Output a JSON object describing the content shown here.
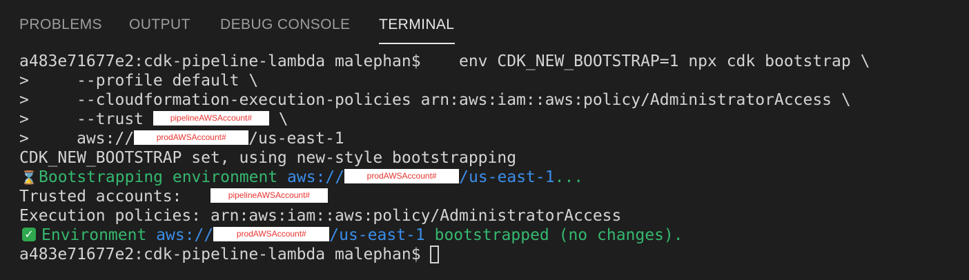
{
  "tabs": {
    "problems": "PROBLEMS",
    "output": "OUTPUT",
    "debug_console": "DEBUG CONSOLE",
    "terminal": "TERMINAL"
  },
  "terminal": {
    "prompt": "a483e71677e2:cdk-pipeline-lambda malephan$",
    "command": "    env CDK_NEW_BOOTSTRAP=1 npx cdk bootstrap \\",
    "cont1": ">     --profile default \\",
    "cont2": ">     --cloudformation-execution-policies arn:aws:iam::aws:policy/AdministratorAccess \\",
    "cont3_prefix": ">     --trust ",
    "cont3_redact": "pipelineAWSAccount#",
    "cont3_suffix": " \\",
    "cont4_prefix": ">     aws://",
    "cont4_redact": "prodAWSAccount#",
    "cont4_suffix": "/us-east-1",
    "out1": "CDK_NEW_BOOTSTRAP set, using new-style bootstrapping",
    "out2_text": "Bootstrapping environment ",
    "out2_aws": "aws://",
    "out2_redact": "prodAWSAccount#",
    "out2_suffix": "/us-east-1",
    "out2_dots": "...",
    "out3_label": "Trusted accounts:   ",
    "out3_redact": "pipelineAWSAccount#",
    "out4": "Execution policies: arn:aws:iam::aws:policy/AdministratorAccess",
    "out5_text": "Environment ",
    "out5_aws": "aws://",
    "out5_redact": "prodAWSAccount#",
    "out5_suffix": "/us-east-1",
    "out5_end": " bootstrapped (no changes).",
    "final_prompt": "a483e71677e2:cdk-pipeline-lambda malephan$ "
  },
  "colors": {
    "background": "#1e1e1e",
    "text": "#d4d4d4",
    "green": "#35b86f",
    "blue": "#3b8eea",
    "redaction_text": "#e8322e"
  },
  "icons": {
    "hourglass": "hourglass-icon",
    "checkmark": "checkmark-icon"
  }
}
